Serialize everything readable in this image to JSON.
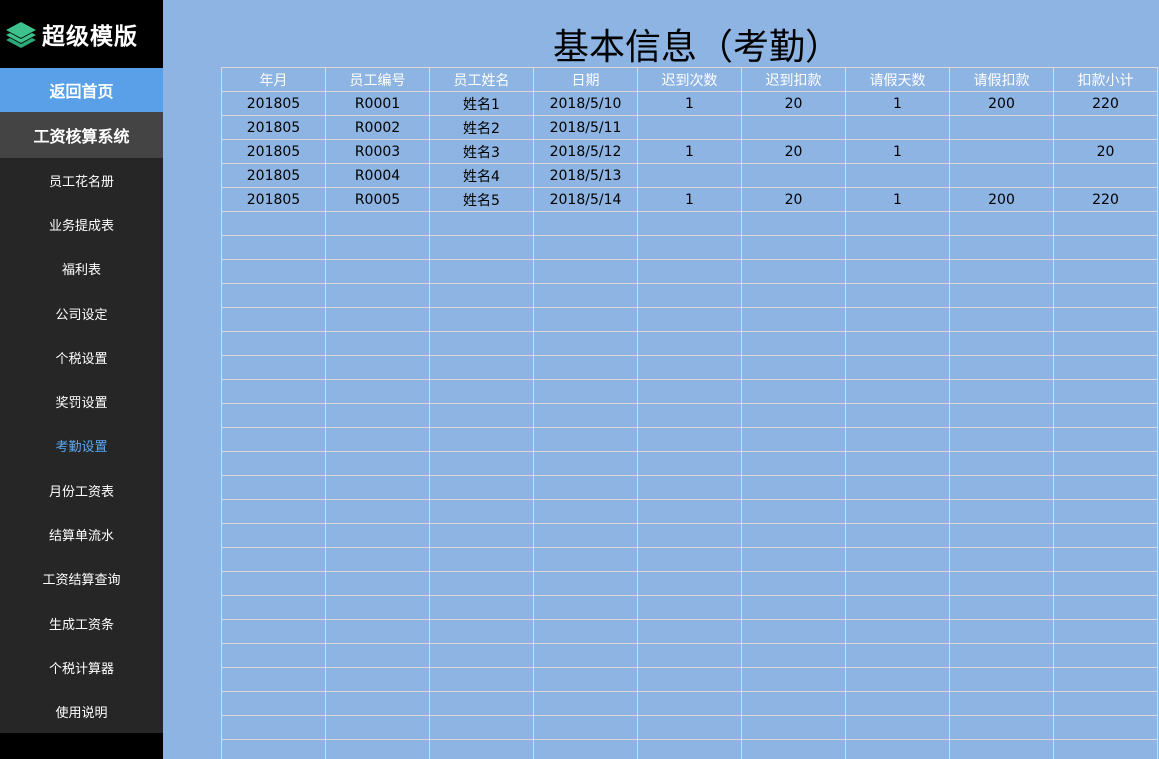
{
  "logo": {
    "text": "超级模版",
    "colors": {
      "icon": "#3cc28a"
    }
  },
  "sidebar": {
    "home_label": "返回首页",
    "system_title": "工资核算系统",
    "items": [
      {
        "label": "员工花名册",
        "active": false
      },
      {
        "label": "业务提成表",
        "active": false
      },
      {
        "label": "福利表",
        "active": false
      },
      {
        "label": "公司设定",
        "active": false
      },
      {
        "label": "个税设置",
        "active": false
      },
      {
        "label": "奖罚设置",
        "active": false
      },
      {
        "label": "考勤设置",
        "active": true
      },
      {
        "label": "月份工资表",
        "active": false
      },
      {
        "label": "结算单流水",
        "active": false
      },
      {
        "label": "工资结算查询",
        "active": false
      },
      {
        "label": "生成工资条",
        "active": false
      },
      {
        "label": "个税计算器",
        "active": false
      },
      {
        "label": "使用说明",
        "active": false
      }
    ]
  },
  "page": {
    "title": "基本信息（考勤）"
  },
  "table": {
    "headers": [
      "年月",
      "员工编号",
      "员工姓名",
      "日期",
      "迟到次数",
      "迟到扣款",
      "请假天数",
      "请假扣款",
      "扣款小计"
    ],
    "rows": [
      [
        "201805",
        "R0001",
        "姓名1",
        "2018/5/10",
        "1",
        "20",
        "1",
        "200",
        "220"
      ],
      [
        "201805",
        "R0002",
        "姓名2",
        "2018/5/11",
        "",
        "",
        "",
        "",
        ""
      ],
      [
        "201805",
        "R0003",
        "姓名3",
        "2018/5/12",
        "1",
        "20",
        "1",
        "",
        "20"
      ],
      [
        "201805",
        "R0004",
        "姓名4",
        "2018/5/13",
        "",
        "",
        "",
        "",
        ""
      ],
      [
        "201805",
        "R0005",
        "姓名5",
        "2018/5/14",
        "1",
        "20",
        "1",
        "200",
        "220"
      ]
    ],
    "empty_rows": 23
  },
  "colors": {
    "background": "#8db4e2",
    "sidebar": "#262626",
    "home_button": "#5aa0e8",
    "active_item": "#5aa7f0",
    "grid_line": "#d9d9d9"
  }
}
